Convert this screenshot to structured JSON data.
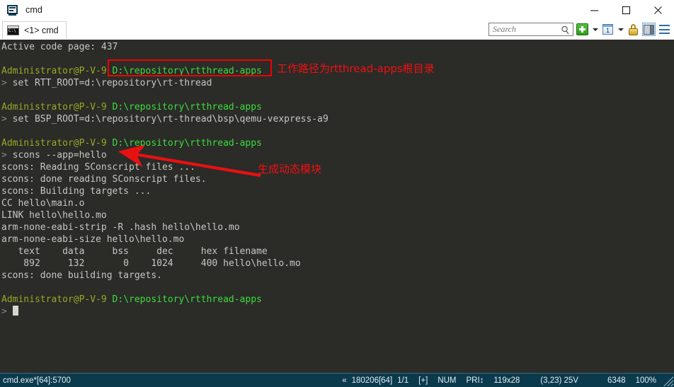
{
  "window": {
    "title": "cmd",
    "app_icon": "console-icon",
    "minimize_label": "–",
    "maximize_label": "□",
    "close_label": "×"
  },
  "tabs": [
    {
      "label": "<1> cmd",
      "icon": "console-tab-icon",
      "active": true
    }
  ],
  "toolbar": {
    "search": {
      "placeholder": "Search",
      "value": ""
    },
    "new_tab_label": "+",
    "window_number": "1",
    "icons": [
      "plus-icon",
      "chevron-down-icon",
      "window-number-icon",
      "chevron-down-icon",
      "lock-icon",
      "split-pane-icon",
      "hamburger-menu-icon"
    ]
  },
  "terminal": {
    "lines": [
      {
        "text": "Active code page: 437",
        "type": "out"
      },
      {
        "text": "",
        "type": "blank"
      },
      {
        "user": "Administrator@P-V-9",
        "path": "D:\\repository\\rtthread-apps",
        "type": "prompt"
      },
      {
        "text": "> set RTT_ROOT=d:\\repository\\rt-thread",
        "type": "cmd"
      },
      {
        "text": "",
        "type": "blank"
      },
      {
        "user": "Administrator@P-V-9",
        "path": "D:\\repository\\rtthread-apps",
        "type": "prompt"
      },
      {
        "text": "> set BSP_ROOT=d:\\repository\\rt-thread\\bsp\\qemu-vexpress-a9",
        "type": "cmd"
      },
      {
        "text": "",
        "type": "blank"
      },
      {
        "user": "Administrator@P-V-9",
        "path": "D:\\repository\\rtthread-apps",
        "type": "prompt"
      },
      {
        "text": "> scons --app=hello",
        "type": "cmd"
      },
      {
        "text": "scons: Reading SConscript files ...",
        "type": "out"
      },
      {
        "text": "scons: done reading SConscript files.",
        "type": "out"
      },
      {
        "text": "scons: Building targets ...",
        "type": "out"
      },
      {
        "text": "CC hello\\main.o",
        "type": "out"
      },
      {
        "text": "LINK hello\\hello.mo",
        "type": "out"
      },
      {
        "text": "arm-none-eabi-strip -R .hash hello\\hello.mo",
        "type": "out"
      },
      {
        "text": "arm-none-eabi-size hello\\hello.mo",
        "type": "out"
      },
      {
        "text": "   text    data     bss     dec     hex filename",
        "type": "out"
      },
      {
        "text": "    892     132       0    1024     400 hello\\hello.mo",
        "type": "out"
      },
      {
        "text": "scons: done building targets.",
        "type": "out"
      },
      {
        "text": "",
        "type": "blank"
      },
      {
        "user": "Administrator@P-V-9",
        "path": "D:\\repository\\rtthread-apps",
        "type": "prompt"
      },
      {
        "text": "> ",
        "type": "cursor"
      }
    ],
    "colors": {
      "background": "#2b2b28",
      "output": "#c5c8c6",
      "user": "#9aa823",
      "path": "#3ddc3d",
      "cursor": "#d6d6cc"
    }
  },
  "annotations": [
    {
      "id": "path-highlight",
      "kind": "box",
      "color": "#f00000"
    },
    {
      "id": "path-note",
      "kind": "text",
      "text": "工作路径为rtthread-apps根目录",
      "color": "#ef1111"
    },
    {
      "id": "module-note",
      "kind": "text",
      "text": "生成动态模块",
      "color": "#ef1111"
    },
    {
      "id": "module-arrow",
      "kind": "arrow",
      "color": "#e81111"
    }
  ],
  "statusbar": {
    "process": "cmd.exe*[64]:5700",
    "chevron": "«",
    "build": "180206[64]",
    "session": "1/1",
    "flag": "[+]",
    "num_lock": "NUM",
    "priority": "PRI↕",
    "size": "119x28",
    "cursor_pos": "(3,23) 25V",
    "memory": "6348",
    "zoom": "100%"
  }
}
